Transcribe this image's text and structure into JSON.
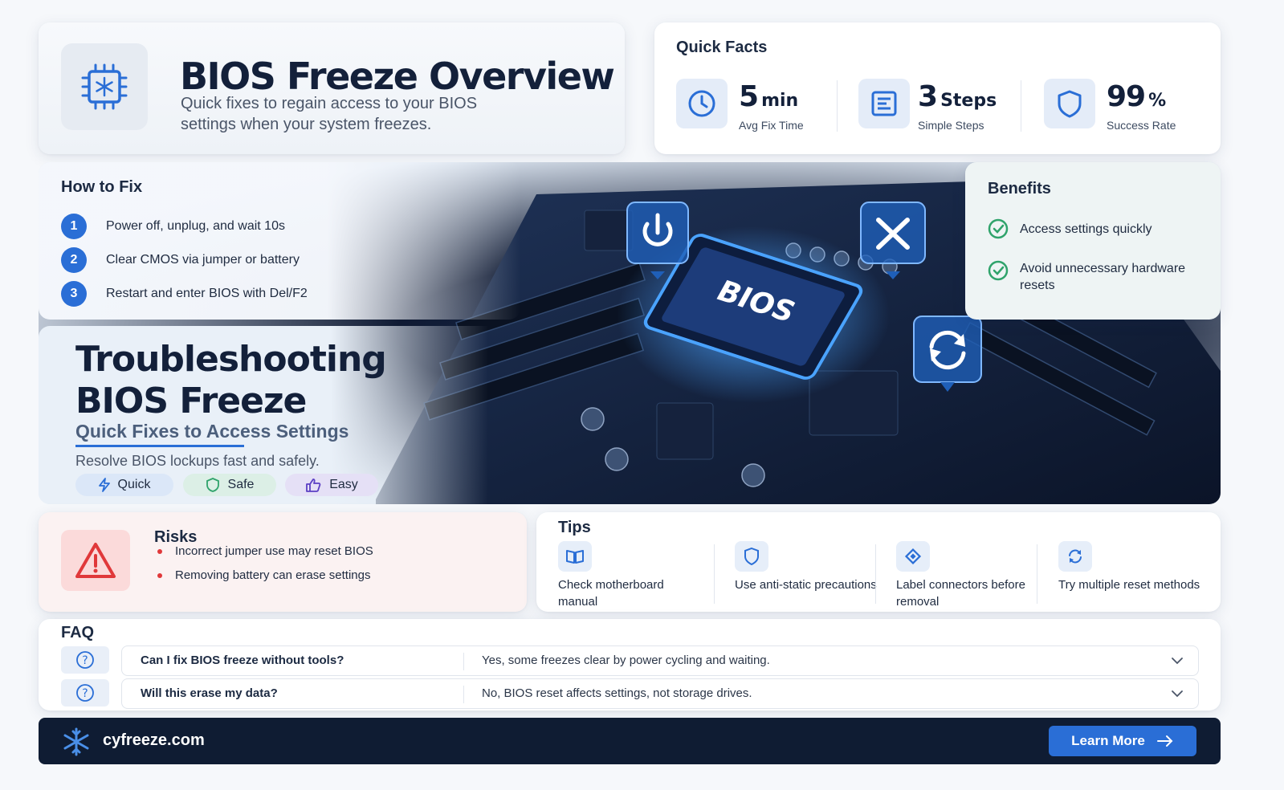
{
  "header": {
    "title": "BIOS Freeze Overview",
    "subtitle": "Quick fixes to regain access to your BIOS settings when your system freezes.",
    "icon": "snowflake-chip-icon"
  },
  "quick_facts": {
    "title": "Quick Facts",
    "items": [
      {
        "value": "5",
        "unit": "min",
        "label": "Avg Fix Time",
        "icon": "clock-icon"
      },
      {
        "value": "3",
        "unit": "Steps",
        "label": "Simple Steps",
        "icon": "checklist-icon"
      },
      {
        "value": "99",
        "unit": "%",
        "label": "Success Rate",
        "icon": "shield-icon"
      }
    ]
  },
  "how_to_fix": {
    "title": "How to Fix",
    "steps": [
      {
        "num": "1",
        "text": "Power off, unplug, and wait 10s"
      },
      {
        "num": "2",
        "text": "Clear CMOS via jumper or battery"
      },
      {
        "num": "3",
        "text": "Restart and enter BIOS with Del/F2"
      }
    ]
  },
  "benefits": {
    "title": "Benefits",
    "items": [
      {
        "text": "Access settings quickly"
      },
      {
        "text": "Avoid unnecessary hardware resets"
      }
    ]
  },
  "hero": {
    "chip_label": "BIOS",
    "title": "Troubleshooting BIOS Freeze",
    "subtitle": "Quick Fixes to Access Settings",
    "description": "Resolve BIOS lockups fast and safely.",
    "tags": [
      {
        "label": "Quick",
        "icon": "lightning-icon",
        "color": "#dbe7f8"
      },
      {
        "label": "Safe",
        "icon": "shield-check-icon",
        "color": "#dcefe6"
      },
      {
        "label": "Easy",
        "icon": "thumbs-up-icon",
        "color": "#e5e0f6"
      }
    ]
  },
  "risks": {
    "title": "Risks",
    "items": [
      "Incorrect jumper use may reset BIOS",
      "Removing battery can erase settings"
    ]
  },
  "tips": {
    "title": "Tips",
    "items": [
      {
        "text": "Check motherboard manual",
        "icon": "book-icon"
      },
      {
        "text": "Use anti-static precautions",
        "icon": "shield-icon"
      },
      {
        "text": "Label connectors before removal",
        "icon": "tag-icon"
      },
      {
        "text": "Try multiple reset methods",
        "icon": "refresh-icon"
      }
    ]
  },
  "faq": {
    "title": "FAQ",
    "items": [
      {
        "q": "Can I fix BIOS freeze without tools?",
        "a": "Yes, some freezes clear by power cycling and waiting."
      },
      {
        "q": "Will this erase my data?",
        "a": "No, BIOS reset affects settings, not storage drives."
      }
    ]
  },
  "footer": {
    "domain": "cyfreeze.com",
    "button_label": "Learn More"
  },
  "colors": {
    "accent": "#2a6ed6",
    "footer_bg": "#0f1c33",
    "success": "#2fa36b",
    "danger": "#e0383a"
  }
}
